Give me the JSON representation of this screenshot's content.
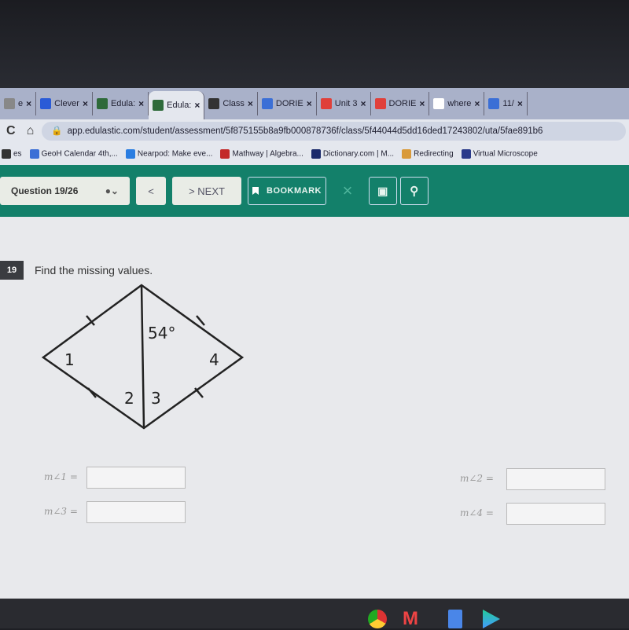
{
  "browser": {
    "tabs": [
      {
        "label": "e",
        "icon": "tab-icon"
      },
      {
        "label": "Clever",
        "icon": "clever-icon"
      },
      {
        "label": "Edula:",
        "icon": "edulastic-icon"
      },
      {
        "label": "Edula:",
        "icon": "edulastic-icon",
        "active": true
      },
      {
        "label": "Class",
        "icon": "classroom-icon"
      },
      {
        "label": "DORIE",
        "icon": "docs-icon"
      },
      {
        "label": "Unit 3",
        "icon": "slides-icon"
      },
      {
        "label": "DORIE",
        "icon": "slides-icon"
      },
      {
        "label": "where",
        "icon": "google-icon"
      },
      {
        "label": "11/",
        "icon": "docs-icon"
      }
    ],
    "close": "×",
    "url": "app.edulastic.com/student/assessment/5f875155b8a9fb000878736f/class/5f44044d5dd16ded17243802/uta/5fae891b6",
    "bookmarks": [
      {
        "label": "es",
        "color": "#333"
      },
      {
        "label": "GeoH Calendar 4th,...",
        "color": "#3b6fd6"
      },
      {
        "label": "Nearpod: Make eve...",
        "color": "#2a7de1"
      },
      {
        "label": "Mathway | Algebra...",
        "color": "#c32a2a"
      },
      {
        "label": "Dictionary.com | M...",
        "color": "#1b2a6b"
      },
      {
        "label": "Redirecting",
        "color": "#d99a3a"
      },
      {
        "label": "Virtual Microscope",
        "color": "#2a3a8a"
      }
    ]
  },
  "toolbar": {
    "question": "Question 19/26",
    "prev": "<",
    "next": "> NEXT",
    "bookmark": "BOOKMARK",
    "close": "×",
    "accent": "#13806a"
  },
  "question": {
    "number": "19",
    "prompt": "Find the missing values.",
    "diagram": {
      "angle_given": "54°",
      "labels": [
        "1",
        "2",
        "3",
        "4"
      ]
    },
    "fields": [
      {
        "label": "m∠1 =",
        "value": ""
      },
      {
        "label": "m∠2 =",
        "value": ""
      },
      {
        "label": "m∠3 =",
        "value": ""
      },
      {
        "label": "m∠4 =",
        "value": ""
      }
    ]
  }
}
